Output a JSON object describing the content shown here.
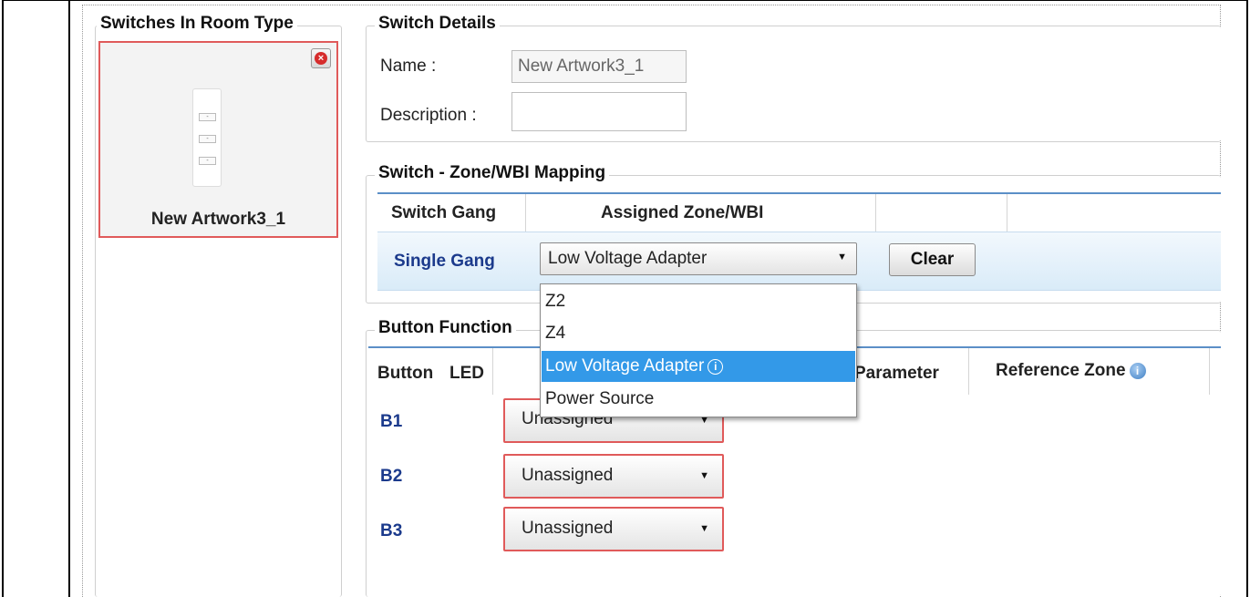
{
  "left_panel": {
    "title": "Switches In Room Type",
    "card": {
      "name": "New Artwork3_1",
      "remove_glyph": "×",
      "plate_buttons": [
        "-",
        "-",
        "-"
      ]
    }
  },
  "switch_details": {
    "title": "Switch Details",
    "name_label": "Name :",
    "name_value": "New Artwork3_1",
    "description_label": "Description :",
    "description_value": ""
  },
  "mapping": {
    "title": "Switch - Zone/WBI Mapping",
    "columns": [
      "Switch Gang",
      "Assigned Zone/WBI"
    ],
    "row": {
      "gang": "Single Gang",
      "selected_zone": "Low Voltage Adapter",
      "clear_label": "Clear"
    },
    "dropdown_options": [
      {
        "label": "Z2",
        "selected": false
      },
      {
        "label": "Z4",
        "selected": false
      },
      {
        "label": "Low Voltage Adapter",
        "selected": true,
        "has_info": true
      },
      {
        "label": "Power Source",
        "selected": false
      }
    ],
    "dropdown_info_glyph": "i"
  },
  "button_functions": {
    "title": "Button Function",
    "columns": {
      "button": "Button",
      "led": "LED",
      "parameter": "Parameter",
      "reference_zone": "Reference Zone"
    },
    "reference_info_glyph": "i",
    "rows": [
      {
        "id": "B1",
        "function": "Unassigned"
      },
      {
        "id": "B2",
        "function": "Unassigned"
      },
      {
        "id": "B3",
        "function": "Unassigned"
      }
    ]
  },
  "colors": {
    "accent_blue": "#3399e8",
    "row_label_blue": "#1b3a8c",
    "invalid_red": "#e05a5a",
    "header_rule": "#5b8fc7"
  },
  "icons": {
    "dropdown_arrow": "▼"
  }
}
